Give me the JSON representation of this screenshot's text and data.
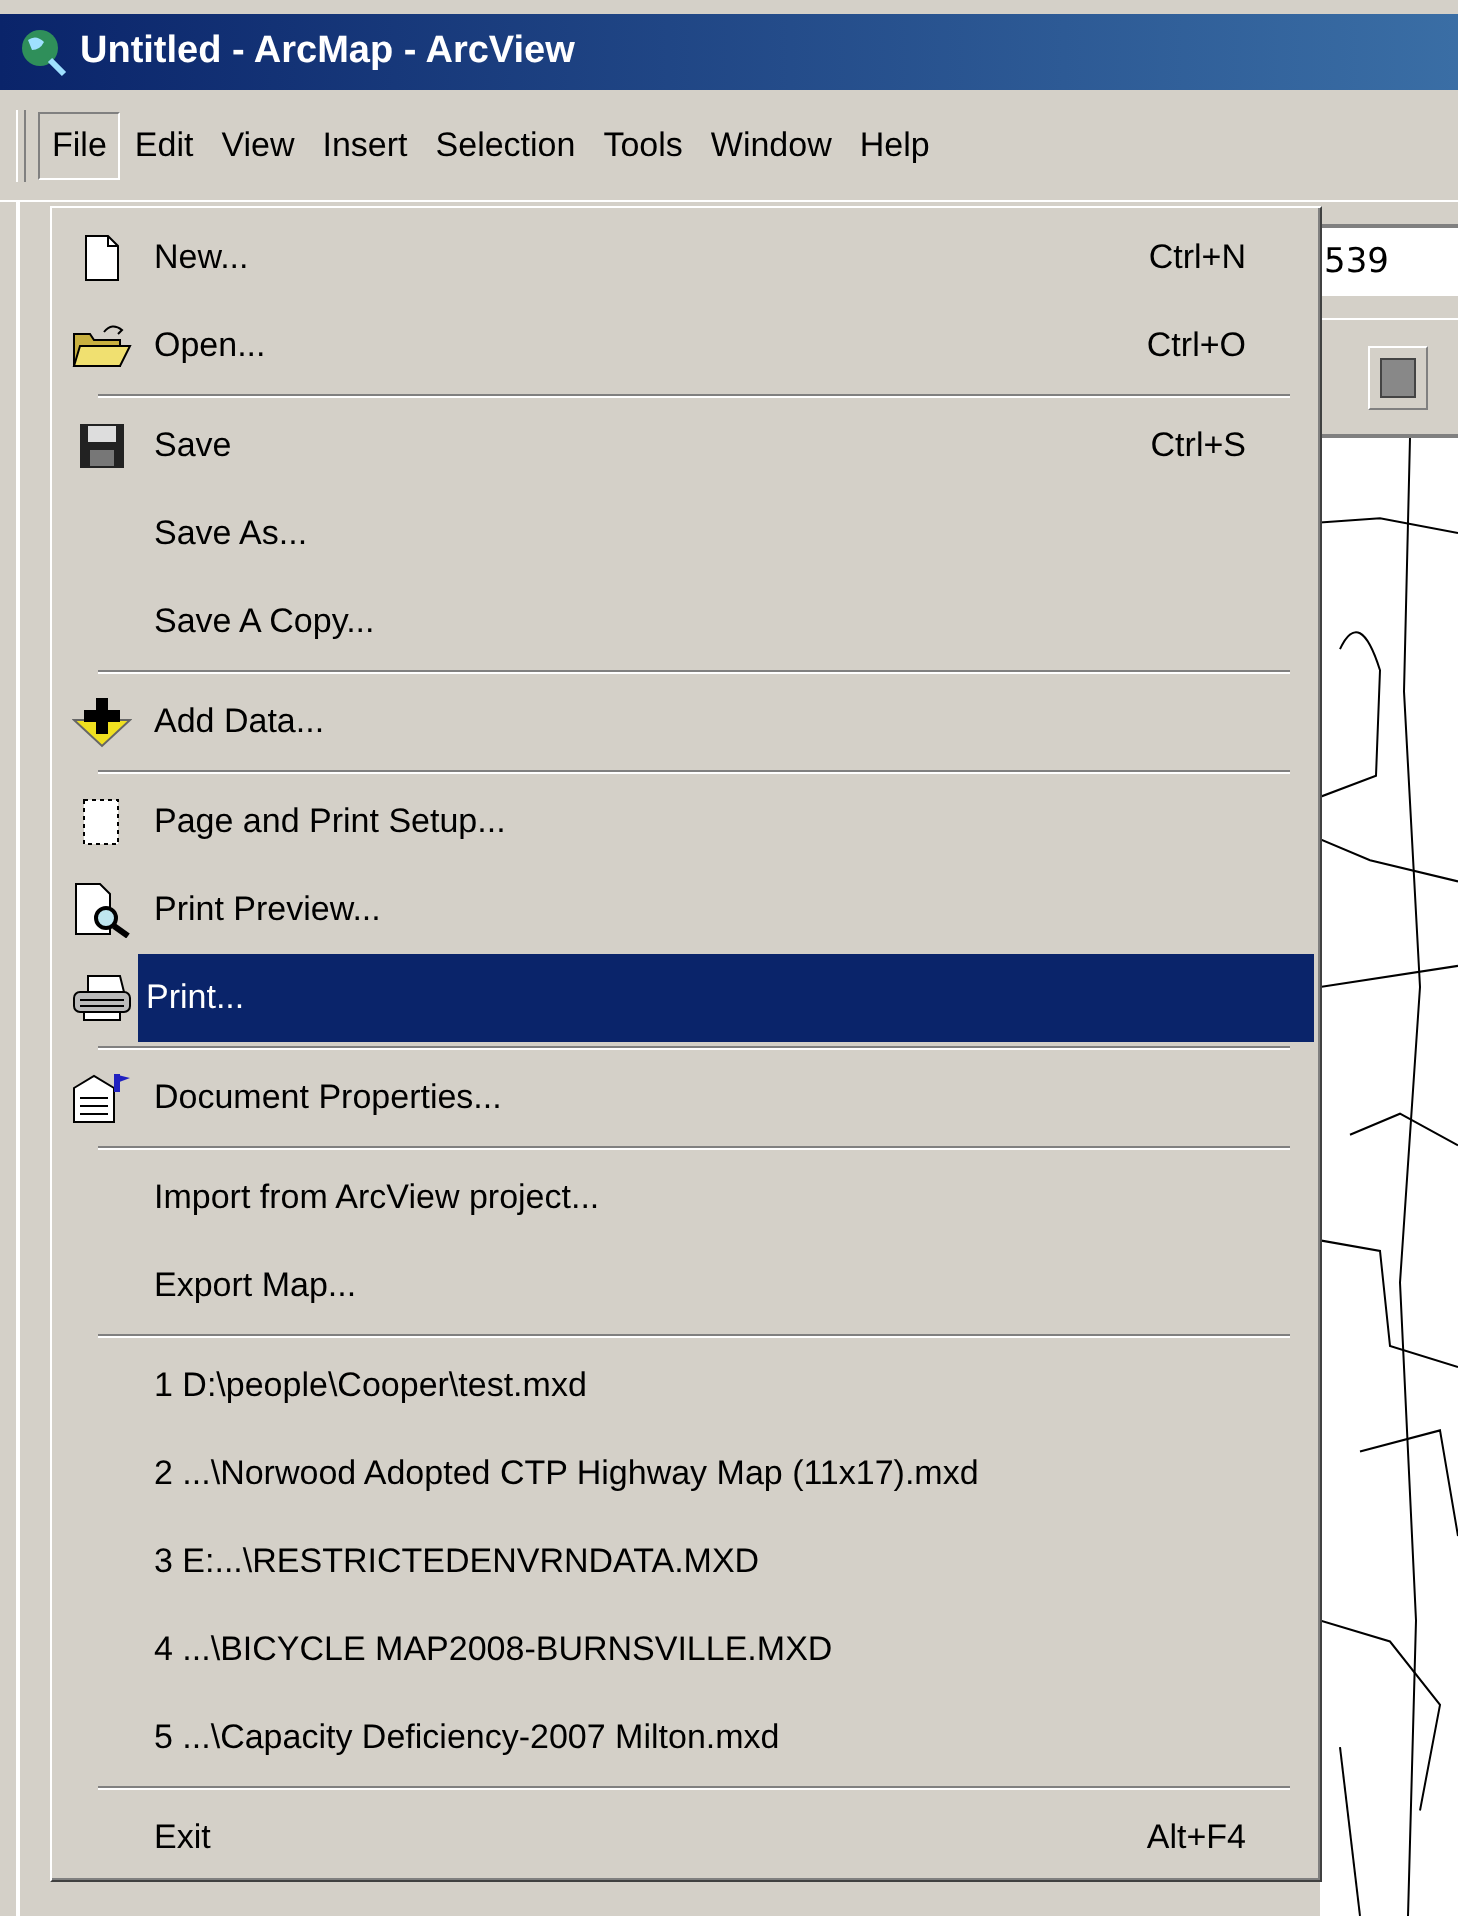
{
  "window": {
    "title": "Untitled - ArcMap - ArcView"
  },
  "menubar": [
    {
      "label": "File",
      "selected": true
    },
    {
      "label": "Edit",
      "selected": false
    },
    {
      "label": "View",
      "selected": false
    },
    {
      "label": "Insert",
      "selected": false
    },
    {
      "label": "Selection",
      "selected": false
    },
    {
      "label": "Tools",
      "selected": false
    },
    {
      "label": "Window",
      "selected": false
    },
    {
      "label": "Help",
      "selected": false
    }
  ],
  "scale_field": {
    "value": "539"
  },
  "file_menu": {
    "sections": [
      [
        {
          "label": "New...",
          "shortcut": "Ctrl+N",
          "selected": false
        },
        {
          "label": "Open...",
          "shortcut": "Ctrl+O",
          "selected": false
        }
      ],
      [
        {
          "label": "Save",
          "shortcut": "Ctrl+S",
          "selected": false
        },
        {
          "label": "Save As...",
          "selected": false
        },
        {
          "label": "Save A Copy...",
          "selected": false
        }
      ],
      [
        {
          "label": "Add Data...",
          "selected": false
        }
      ],
      [
        {
          "label": "Page and Print Setup...",
          "selected": false
        },
        {
          "label": "Print Preview...",
          "selected": false
        },
        {
          "label": "Print...",
          "selected": true
        }
      ],
      [
        {
          "label": "Document Properties...",
          "selected": false
        }
      ],
      [
        {
          "label": "Import from ArcView project...",
          "selected": false
        },
        {
          "label": "Export Map...",
          "selected": false
        }
      ],
      [
        {
          "label": "1 D:\\people\\Cooper\\test.mxd",
          "selected": false
        },
        {
          "label": "2 ...\\Norwood Adopted CTP Highway Map (11x17).mxd",
          "selected": false
        },
        {
          "label": "3 E:...\\RESTRICTEDENVRNDATA.MXD",
          "selected": false
        },
        {
          "label": "4 ...\\BICYCLE MAP2008-BURNSVILLE.MXD",
          "selected": false
        },
        {
          "label": "5 ...\\Capacity Deficiency-2007 Milton.mxd",
          "selected": false
        }
      ],
      [
        {
          "label": "Exit",
          "shortcut": "Alt+F4",
          "selected": false
        }
      ]
    ]
  }
}
